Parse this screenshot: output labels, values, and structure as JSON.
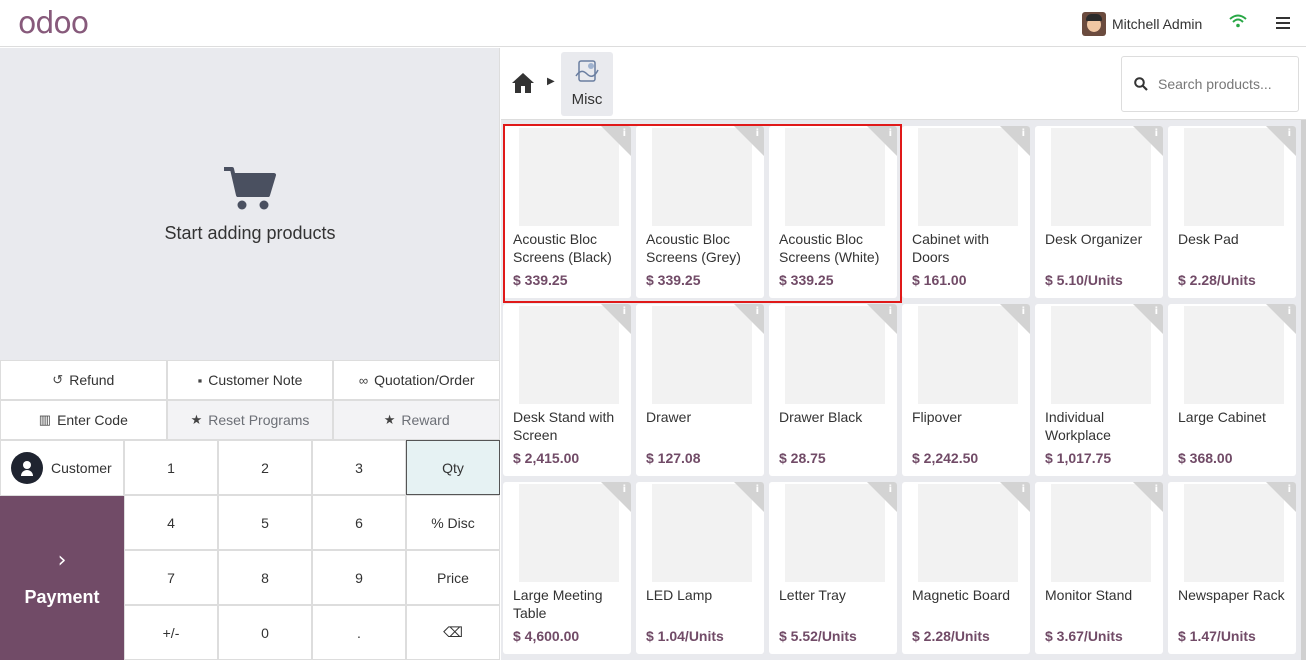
{
  "navbar": {
    "logo": "odoo",
    "user_name": "Mitchell Admin",
    "icons": [
      "wifi-icon",
      "menu-icon"
    ]
  },
  "order": {
    "empty_text": "Start adding products"
  },
  "controls": {
    "refund": "Refund",
    "customer_note": "Customer Note",
    "quotation_order": "Quotation/Order",
    "enter_code": "Enter Code",
    "reset_programs": "Reset Programs",
    "reward": "Reward"
  },
  "pad": {
    "customer": "Customer",
    "payment": "Payment",
    "keys": [
      "1",
      "2",
      "3",
      "Qty",
      "4",
      "5",
      "6",
      "% Disc",
      "7",
      "8",
      "9",
      "Price",
      "+/-",
      "0",
      ".",
      "⌫"
    ]
  },
  "breadcrumb": {
    "category": "Misc"
  },
  "search": {
    "placeholder": "Search products..."
  },
  "products": [
    {
      "name": "Acoustic Bloc Screens (Black)",
      "price": "$ 339.25"
    },
    {
      "name": "Acoustic Bloc Screens (Grey)",
      "price": "$ 339.25"
    },
    {
      "name": "Acoustic Bloc Screens (White)",
      "price": "$ 339.25"
    },
    {
      "name": "Cabinet with Doors",
      "price": "$ 161.00"
    },
    {
      "name": "Desk Organizer",
      "price": "$ 5.10/Units"
    },
    {
      "name": "Desk Pad",
      "price": "$ 2.28/Units"
    },
    {
      "name": "Desk Stand with Screen",
      "price": "$ 2,415.00"
    },
    {
      "name": "Drawer",
      "price": "$ 127.08"
    },
    {
      "name": "Drawer Black",
      "price": "$ 28.75"
    },
    {
      "name": "Flipover",
      "price": "$ 2,242.50"
    },
    {
      "name": "Individual Workplace",
      "price": "$ 1,017.75"
    },
    {
      "name": "Large Cabinet",
      "price": "$ 368.00"
    },
    {
      "name": "Large Meeting Table",
      "price": "$ 4,600.00"
    },
    {
      "name": "LED Lamp",
      "price": "$ 1.04/Units"
    },
    {
      "name": "Letter Tray",
      "price": "$ 5.52/Units"
    },
    {
      "name": "Magnetic Board",
      "price": "$ 2.28/Units"
    },
    {
      "name": "Monitor Stand",
      "price": "$ 3.67/Units"
    },
    {
      "name": "Newspaper Rack",
      "price": "$ 1.47/Units"
    }
  ],
  "colors": {
    "brand": "#714b67",
    "highlight": "#e01919"
  }
}
